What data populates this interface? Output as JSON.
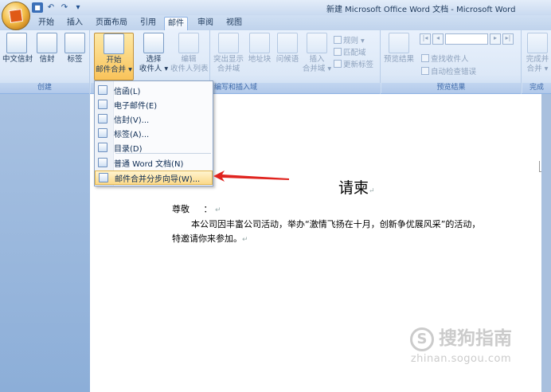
{
  "window": {
    "title": "新建 Microsoft Office Word 文档 - Microsoft Word"
  },
  "qat": {
    "save_icon": "save-icon",
    "undo_icon": "undo-icon",
    "redo_icon": "redo-icon",
    "more_label": "▾"
  },
  "tabs": [
    {
      "label": "开始"
    },
    {
      "label": "插入"
    },
    {
      "label": "页面布局"
    },
    {
      "label": "引用"
    },
    {
      "label": "邮件",
      "active": true
    },
    {
      "label": "审阅"
    },
    {
      "label": "视图"
    }
  ],
  "ribbon": {
    "create": {
      "label": "创建",
      "buttons": [
        {
          "label": "中文信封"
        },
        {
          "label": "信封"
        },
        {
          "label": "标签"
        }
      ]
    },
    "start_merge": {
      "label": "",
      "start": {
        "line1": "开始",
        "line2": "邮件合并 ▾"
      },
      "select": {
        "line1": "选择",
        "line2": "收件人 ▾"
      },
      "edit": {
        "line1": "编辑",
        "line2": "收件人列表"
      }
    },
    "write_insert": {
      "label": "编写和插入域",
      "highlight": {
        "line1": "突出显示",
        "line2": "合并域"
      },
      "address": {
        "line1": "地址块"
      },
      "greeting": {
        "line1": "问候语"
      },
      "insert": {
        "line1": "插入",
        "line2": "合并域 ▾"
      },
      "rules": "规则 ▾",
      "match": "匹配域",
      "update": "更新标签"
    },
    "preview": {
      "label": "预览结果",
      "preview_btn": "预览结果",
      "find": "查找收件人",
      "check": "自动检查错误"
    },
    "finish": {
      "label": "完成",
      "btn": {
        "line1": "完成并",
        "line2": "合并 ▾"
      }
    }
  },
  "dropdown": {
    "items": [
      {
        "label": "信函(L)"
      },
      {
        "label": "电子邮件(E)"
      },
      {
        "label": "信封(V)..."
      },
      {
        "label": "标签(A)..."
      },
      {
        "label": "目录(D)"
      },
      {
        "label": "普通 Word 文档(N)"
      },
      {
        "label": "邮件合并分步向导(W)...",
        "highlighted": true
      }
    ]
  },
  "document": {
    "title": "请柬",
    "salutation": "尊敬",
    "colon": "：",
    "body_line1": "本公司因丰富公司活动，举办“激情飞扬在十月，创新争优展风采”的活动，",
    "body_line2": "特邀请你来参加。",
    "para_mark": "↵"
  },
  "watermark": {
    "brand": "搜狗指南",
    "url": "zhinan.sogou.com"
  },
  "colors": {
    "accent": "#1e395b",
    "menu_highlight": "#fbd98a",
    "arrow": "#e0241f"
  }
}
